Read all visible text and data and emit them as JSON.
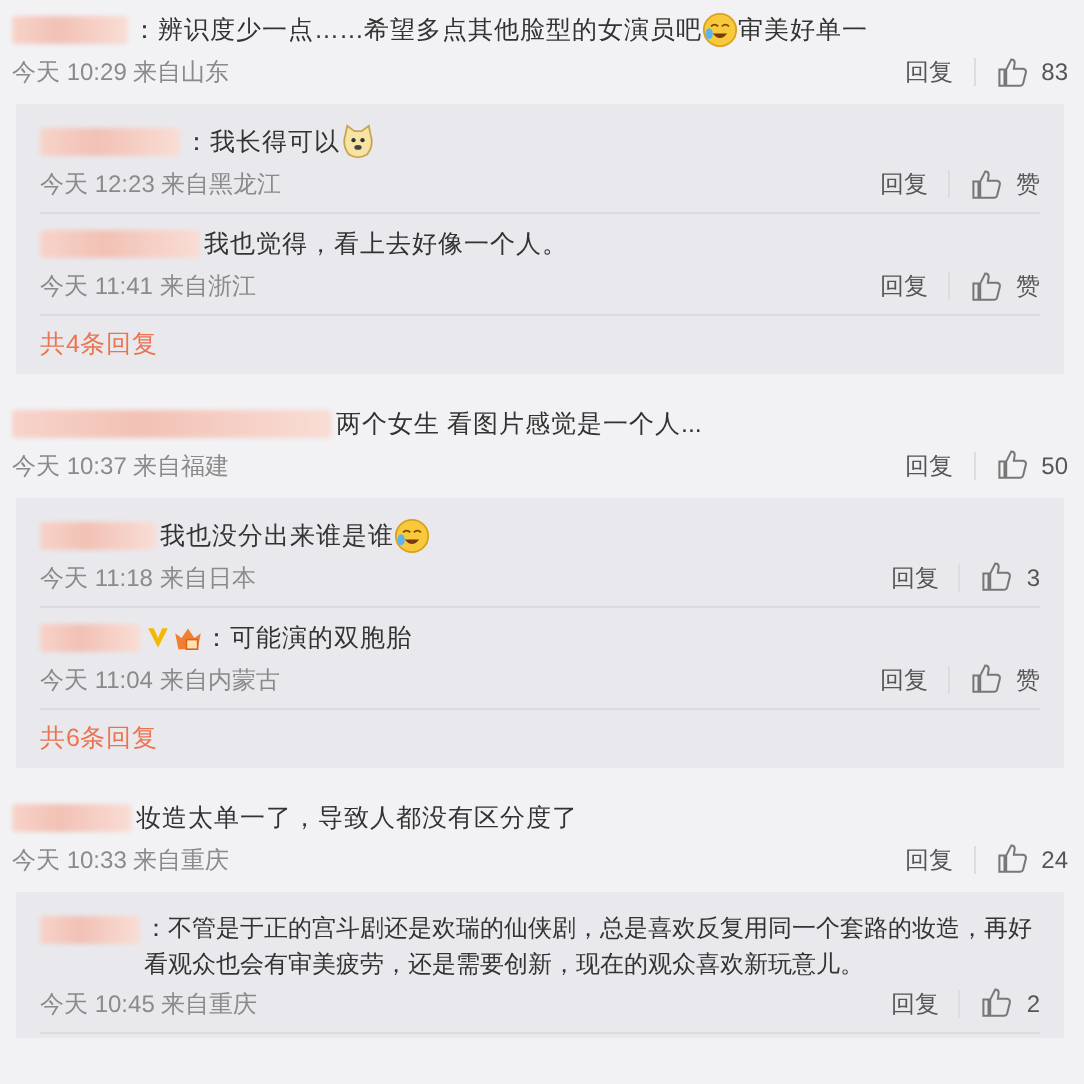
{
  "comments": [
    {
      "content": [
        {
          "kind": "text",
          "text": "：辨识度少一点……希望多点其他脸型的女演员吧"
        },
        {
          "kind": "laugh"
        },
        {
          "kind": "text",
          "text": "审美好单一"
        }
      ],
      "time": "今天 10:29",
      "location": "来自山东",
      "reply_label": "回复",
      "likes": "83",
      "replies": [
        {
          "content": [
            {
              "kind": "text",
              "text": "：我长得可以"
            },
            {
              "kind": "doge"
            }
          ],
          "verified": false,
          "vip": false,
          "time": "今天 12:23",
          "location": "来自黑龙江",
          "reply_label": "回复",
          "likes": "赞"
        },
        {
          "content": [
            {
              "kind": "text",
              "text": "我也觉得，看上去好像一个人。"
            }
          ],
          "verified": false,
          "vip": false,
          "time": "今天 11:41",
          "location": "来自浙江",
          "reply_label": "回复",
          "likes": "赞"
        }
      ],
      "more": "共4条回复"
    },
    {
      "content": [
        {
          "kind": "text",
          "text": "两个女生 看图片感觉是一个人..."
        }
      ],
      "time": "今天 10:37",
      "location": "来自福建",
      "reply_label": "回复",
      "likes": "50",
      "replies": [
        {
          "content": [
            {
              "kind": "text",
              "text": "我也没分出来谁是谁"
            },
            {
              "kind": "laugh"
            }
          ],
          "verified": false,
          "vip": false,
          "time": "今天 11:18",
          "location": "来自日本",
          "reply_label": "回复",
          "likes": "3"
        },
        {
          "content": [
            {
              "kind": "text",
              "text": "：可能演的双胞胎"
            }
          ],
          "verified": true,
          "vip": true,
          "time": "今天 11:04",
          "location": "来自内蒙古",
          "reply_label": "回复",
          "likes": "赞"
        }
      ],
      "more": "共6条回复"
    },
    {
      "content": [
        {
          "kind": "text",
          "text": "妆造太单一了，导致人都没有区分度了"
        }
      ],
      "time": "今天 10:33",
      "location": "来自重庆",
      "reply_label": "回复",
      "likes": "24",
      "replies": [
        {
          "content": [
            {
              "kind": "text",
              "text": "：不管是于正的宫斗剧还是欢瑞的仙侠剧，总是喜欢反复用同一个套路的妆造，再好看观众也会有审美疲劳，还是需要创新，现在的观众喜欢新玩意儿。"
            }
          ],
          "verified": false,
          "vip": false,
          "time": "今天 10:45",
          "location": "来自重庆",
          "reply_label": "回复",
          "likes": "2"
        }
      ]
    }
  ]
}
